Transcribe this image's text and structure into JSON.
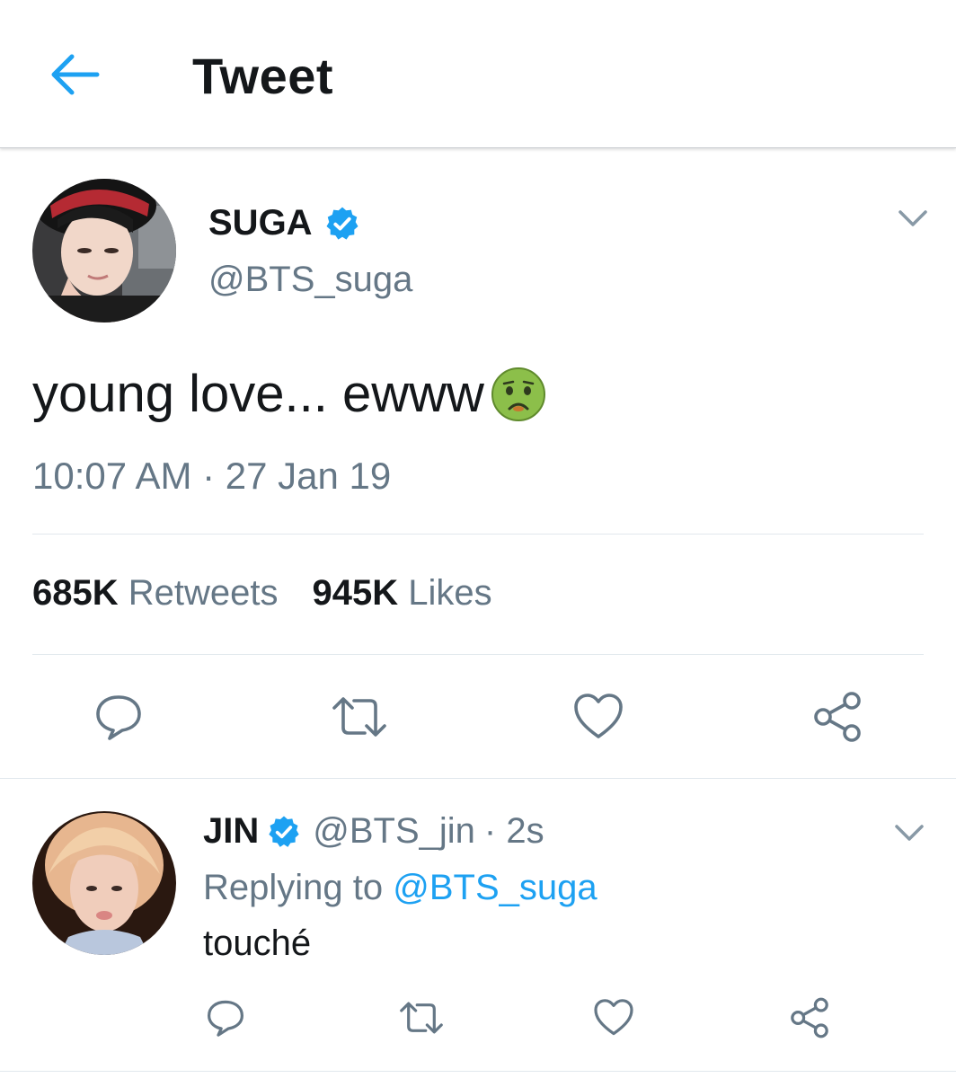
{
  "header": {
    "title": "Tweet",
    "back_icon": "arrow-left-icon"
  },
  "colors": {
    "accent": "#1da1f2",
    "secondary_text": "#657786",
    "primary_text": "#14171a",
    "divider": "#e1e8ed"
  },
  "tweet": {
    "author": {
      "name": "SUGA",
      "handle": "@BTS_suga",
      "verified": true
    },
    "text": "young love... ewww",
    "emoji": "nauseated-face-icon",
    "timestamp": "10:07 AM · 27 Jan 19",
    "stats": {
      "retweets_count": "685K",
      "retweets_label": "Retweets",
      "likes_count": "945K",
      "likes_label": "Likes"
    },
    "actions": [
      "reply-icon",
      "retweet-icon",
      "like-icon",
      "share-icon"
    ]
  },
  "reply": {
    "author": {
      "name": "JIN",
      "handle": "@BTS_jin",
      "verified": true
    },
    "time": "· 2s",
    "replying_prefix": "Replying to",
    "replying_to": "@BTS_suga",
    "text": "touché",
    "actions": [
      "reply-icon",
      "retweet-icon",
      "like-icon",
      "share-icon"
    ]
  }
}
